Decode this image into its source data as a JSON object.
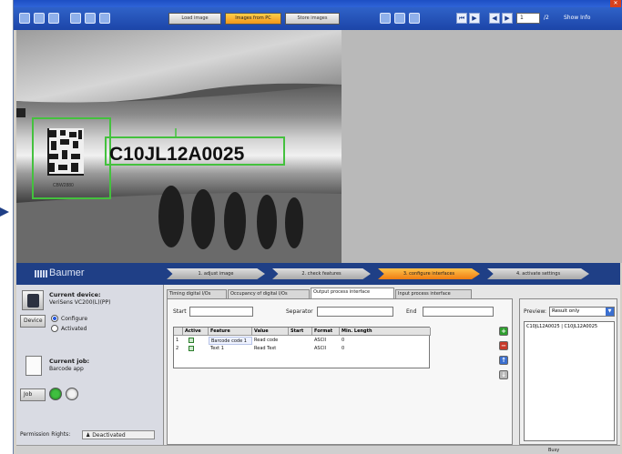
{
  "toolbar": {
    "buttons": [
      {
        "label": "Load image",
        "active": false
      },
      {
        "label": "Images from PC",
        "active": true
      },
      {
        "label": "Store images",
        "active": false
      }
    ],
    "page": {
      "current": "1",
      "total": "/2"
    },
    "view_label": "Show Info"
  },
  "camera": {
    "code_text": "C10JL12A0025",
    "small_label": "CBW2880"
  },
  "brand": {
    "name": "Baumer"
  },
  "steps": [
    {
      "label": "1. adjust image",
      "active": false
    },
    {
      "label": "2. check features",
      "active": false
    },
    {
      "label": "3. configure interfaces",
      "active": true
    },
    {
      "label": "4. activate settings",
      "active": false
    }
  ],
  "left_panel": {
    "device_title": "Current device:",
    "device_name": "VeriSens VC200(L)(PP)",
    "device_button": "Device",
    "radio_configure": "Configure",
    "radio_activated": "Activated",
    "job_title": "Current job:",
    "job_name": "Barcode app",
    "job_button": "Job",
    "permission_label": "Permission Rights:",
    "permission_value": "Deactivated"
  },
  "tabs": [
    {
      "label": "Timing digital I/Os",
      "active": false
    },
    {
      "label": "Occupancy of digital I/Os",
      "active": false
    },
    {
      "label": "Output process interface",
      "active": true
    },
    {
      "label": "Input process interface",
      "active": false
    }
  ],
  "form": {
    "start_label": "Start",
    "separator_label": "Separator",
    "end_label": "End"
  },
  "grid": {
    "headers": [
      "Active",
      "Feature",
      "Value",
      "Start",
      "Format",
      "Min. Length"
    ],
    "rows": [
      {
        "num": "1",
        "feature": "Barcode code 1",
        "value": "Read code",
        "start": "",
        "format": "ASCII",
        "min_length": "0"
      },
      {
        "num": "2",
        "feature": "Text 1",
        "value": "Read Text",
        "start": "",
        "format": "ASCII",
        "min_length": "0"
      }
    ]
  },
  "preview": {
    "label": "Preview:",
    "select_value": "Result only",
    "text": "C10JL12A0025 | C10JL12A0025"
  },
  "status": {
    "text": "Busy"
  },
  "colors": {
    "accent": "#f2961a",
    "nav": "#1f3f86",
    "code_box": "#44c13e"
  }
}
